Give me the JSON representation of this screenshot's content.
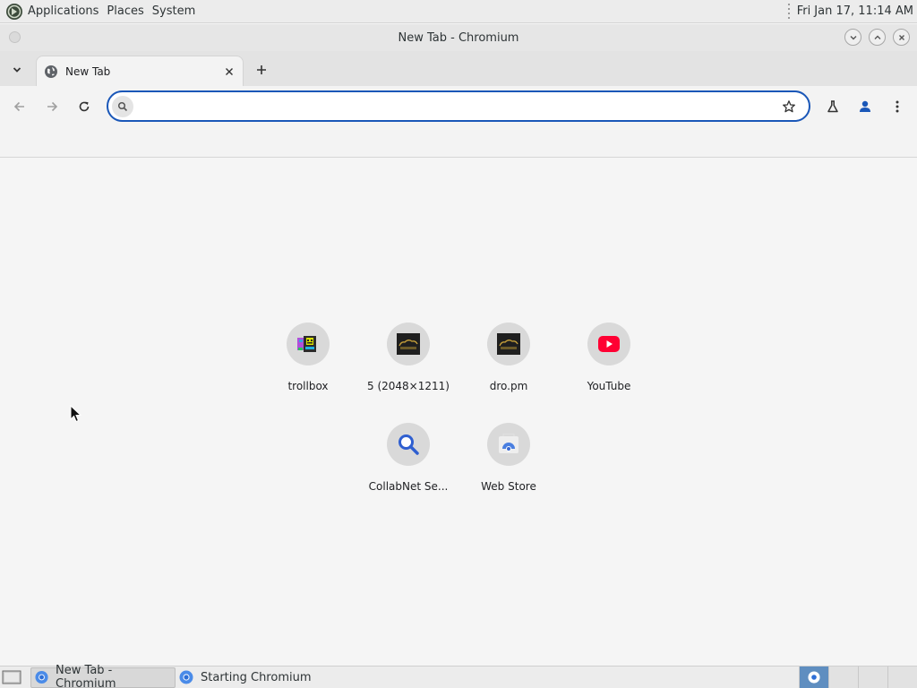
{
  "top_panel": {
    "menus": [
      "Applications",
      "Places",
      "System"
    ],
    "clock": "Fri Jan 17, 11:14 AM"
  },
  "window": {
    "title": "New Tab - Chromium"
  },
  "tabstrip": {
    "tabs": [
      {
        "title": "New Tab",
        "favicon": "globe-icon"
      }
    ]
  },
  "omnibox": {
    "value": "",
    "placeholder": ""
  },
  "shortcuts": [
    {
      "label": "trollbox",
      "icon": "trollbox-icon"
    },
    {
      "label": "5 (2048×1211)",
      "icon": "image-thumbnail-icon"
    },
    {
      "label": "dro.pm",
      "icon": "image-thumbnail-icon"
    },
    {
      "label": "YouTube",
      "icon": "youtube-icon"
    },
    {
      "label": "CollabNet Se...",
      "icon": "magnifier-icon"
    },
    {
      "label": "Web Store",
      "icon": "web-store-icon"
    }
  ],
  "taskbar": {
    "tasks": [
      {
        "label": "New Tab - Chromium",
        "active": true
      },
      {
        "label": "Starting Chromium",
        "active": false
      }
    ],
    "workspace_count": 4
  },
  "colors": {
    "omnibox_focus": "#1a57b8",
    "youtube_red": "#ff0033",
    "workspace_active": "#5f8ec0"
  }
}
